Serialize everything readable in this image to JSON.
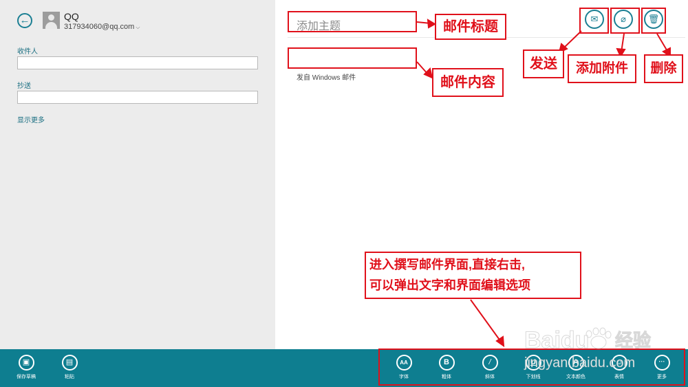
{
  "account": {
    "name": "QQ",
    "email": "317934060@qq.com"
  },
  "fields": {
    "to_label": "收件人",
    "cc_label": "抄送",
    "show_more": "显示更多"
  },
  "compose": {
    "subject_placeholder": "添加主题",
    "signature": "发自 Windows 邮件"
  },
  "app_bar_left": [
    {
      "label": "保存草稿",
      "icon": "save-icon"
    },
    {
      "label": "粘贴",
      "icon": "paste-icon"
    }
  ],
  "app_bar_right": [
    {
      "label": "字体",
      "icon": "font-icon",
      "glyph": "AA"
    },
    {
      "label": "粗体",
      "icon": "bold-icon",
      "glyph": "B"
    },
    {
      "label": "斜体",
      "icon": "italic-icon",
      "glyph": "/"
    },
    {
      "label": "下划线",
      "icon": "underline-icon",
      "glyph": "U"
    },
    {
      "label": "文本颜色",
      "icon": "text-color-icon",
      "glyph": "A"
    },
    {
      "label": "表情",
      "icon": "emoji-icon",
      "glyph": "☺"
    },
    {
      "label": "更多",
      "icon": "more-icon",
      "glyph": "···"
    }
  ],
  "toolbar_icons": [
    "send-icon",
    "attach-icon",
    "delete-icon"
  ],
  "annotations": {
    "subject": "邮件标题",
    "body": "邮件内容",
    "send": "发送",
    "attach": "添加附件",
    "delete": "删除",
    "note_line1": "进入撰写邮件界面,直接右击,",
    "note_line2": "可以弹出文字和界面编辑选项"
  },
  "watermark": {
    "brand": "Baidu",
    "cn": "经验",
    "url": "jingyan.baidu.com"
  },
  "colors": {
    "accent": "#0e7e90",
    "annotation": "#e0101a",
    "pane": "#ececec"
  }
}
